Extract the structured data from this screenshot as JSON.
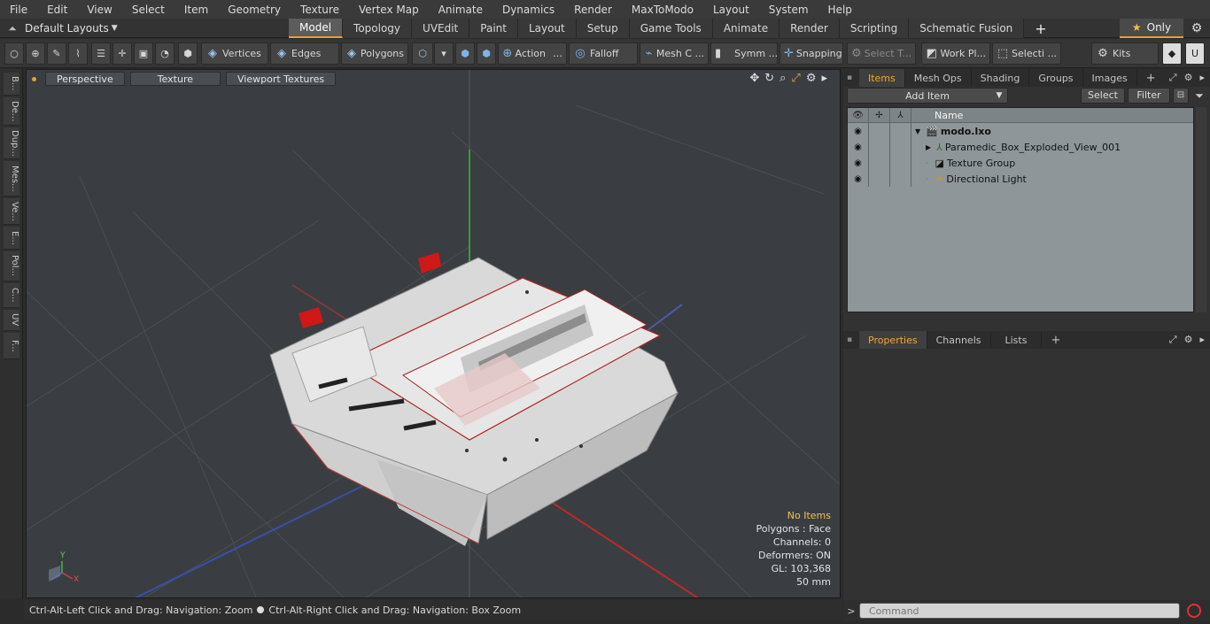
{
  "menu": [
    "File",
    "Edit",
    "View",
    "Select",
    "Item",
    "Geometry",
    "Texture",
    "Vertex Map",
    "Animate",
    "Dynamics",
    "Render",
    "MaxToModo",
    "Layout",
    "System",
    "Help"
  ],
  "layout_selector": "Default Layouts",
  "layout_tabs": [
    "Model",
    "Topology",
    "UVEdit",
    "Paint",
    "Layout",
    "Setup",
    "Game Tools",
    "Animate",
    "Render",
    "Scripting",
    "Schematic Fusion"
  ],
  "layout_tab_active": "Model",
  "only_label": "Only",
  "toolbar": {
    "vertices": "Vertices",
    "edges": "Edges",
    "polygons": "Polygons",
    "action": "Action",
    "falloff": "Falloff",
    "mesh_c": "Mesh C ...",
    "symm": "Symm ...",
    "snapping": "Snapping",
    "select_t": "Select T...",
    "work_pl": "Work Pl...",
    "selecti": "Selecti ...",
    "kits": "Kits"
  },
  "left_tabs": [
    "B...",
    "De...",
    "Dup...",
    "Mes...",
    "Ve...",
    "E...",
    "Pol...",
    "C...",
    "UV",
    "F..."
  ],
  "viewport": {
    "buttons": [
      "Perspective",
      "Texture",
      "Viewport Textures"
    ],
    "info": {
      "no_items": "No Items",
      "polygons": "Polygons : Face",
      "channels": "Channels: 0",
      "deformers": "Deformers: ON",
      "gl": "GL: 103,368",
      "size": "50 mm"
    },
    "axis": {
      "y": "Y",
      "x": "X"
    }
  },
  "status": {
    "left": "Ctrl-Alt-Left Click and Drag: Navigation: Zoom",
    "right": "Ctrl-Alt-Right Click and Drag: Navigation: Box Zoom"
  },
  "items_panel": {
    "tabs": [
      "Items",
      "Mesh Ops",
      "Shading",
      "Groups",
      "Images"
    ],
    "active_tab": "Items",
    "add_item": "Add Item",
    "select": "Select",
    "filter": "Filter",
    "column_name": "Name",
    "tree": [
      {
        "name": "modo.lxo",
        "level": 0,
        "expander": "▼"
      },
      {
        "name": "Paramedic_Box_Exploded_View_001",
        "level": 1,
        "expander": "▶"
      },
      {
        "name": "Texture Group",
        "level": 1,
        "expander": "·"
      },
      {
        "name": "Directional Light",
        "level": 1,
        "expander": "·"
      }
    ]
  },
  "props_panel": {
    "tabs": [
      "Properties",
      "Channels",
      "Lists"
    ],
    "active_tab": "Properties"
  },
  "command": {
    "placeholder": "Command"
  },
  "colors": {
    "accent": "#e1a13a",
    "viewport_bg": "#3a3e42",
    "tree_bg": "#8f9699"
  }
}
